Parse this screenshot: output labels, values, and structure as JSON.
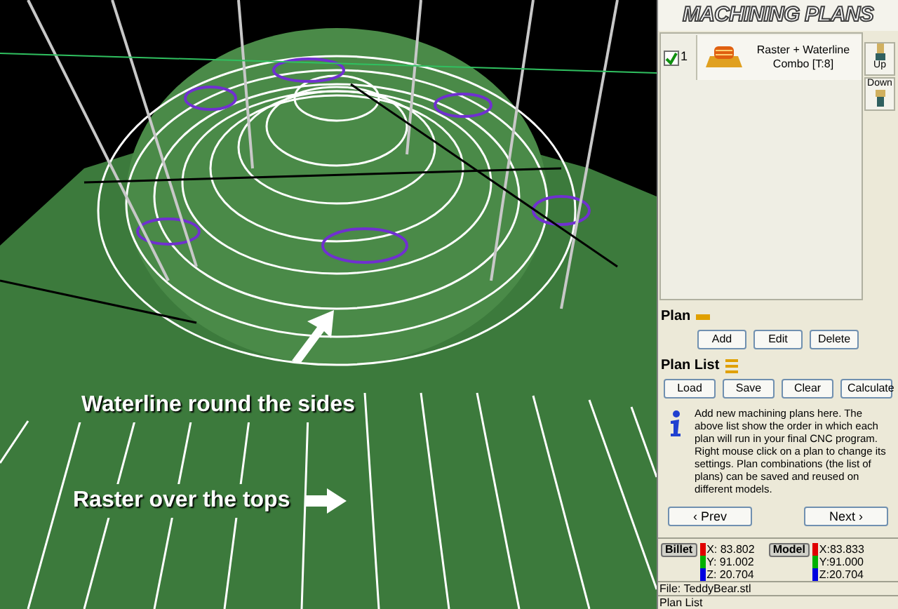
{
  "viewport": {
    "captions": [
      {
        "text": "Waterline round the sides",
        "kind": "up"
      },
      {
        "text": "Raster over the tops",
        "kind": "right"
      }
    ]
  },
  "panel": {
    "title": "MACHINING PLANS",
    "plans": [
      {
        "checked": true,
        "number": "1",
        "name": "Raster + Waterline Combo [T:8]"
      }
    ],
    "move_buttons": [
      {
        "label": "Up",
        "kind": "up"
      },
      {
        "label": "Down",
        "kind": "down"
      }
    ],
    "plan_section": {
      "title": "Plan",
      "buttons": [
        "Add",
        "Edit",
        "Delete"
      ]
    },
    "plan_list_section": {
      "title": "Plan List",
      "buttons": [
        "Load",
        "Save",
        "Clear",
        "Calculate"
      ]
    },
    "info": "Add new machining plans here. The above list show the order in which each plan will run in your final CNC program. Right mouse click on a plan to change its settings. Plan combinations (the list of plans) can be saved and reused on different models.",
    "nav": {
      "prev": "‹ Prev",
      "next": "Next ›"
    },
    "coords": [
      {
        "label": "Billet",
        "values": [
          {
            "text": "X: 83.802",
            "color": "#e00000"
          },
          {
            "text": "Y: 91.002",
            "color": "#00b000"
          },
          {
            "text": "Z: 20.704",
            "color": "#0000e0"
          }
        ]
      },
      {
        "label": "Model",
        "values": [
          {
            "text": "X:83.833",
            "color": "#e00000"
          },
          {
            "text": "Y:91.000",
            "color": "#00b000"
          },
          {
            "text": "Z:20.704",
            "color": "#0000e0"
          }
        ]
      }
    ],
    "status_lines": [
      "File: TeddyBear.stl",
      "Plan List"
    ]
  }
}
